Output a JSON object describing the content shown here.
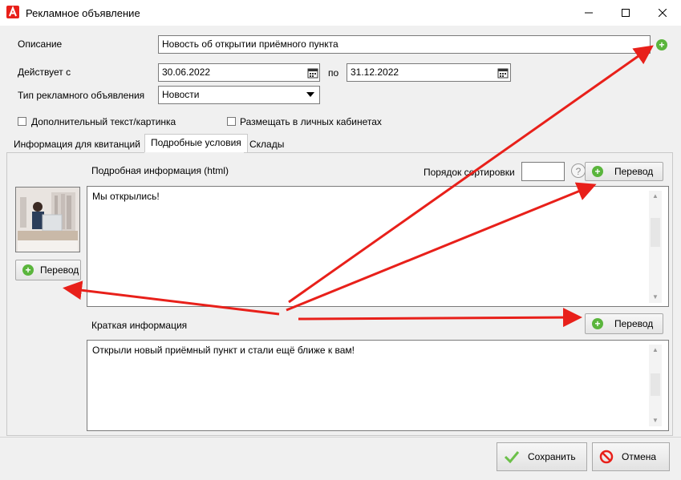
{
  "window": {
    "title": "Рекламное объявление",
    "buttons": [
      "minimize",
      "maximize",
      "close"
    ]
  },
  "form": {
    "description_label": "Описание",
    "description_value": "Новость об открытии приёмного пункта",
    "valid_from_label": "Действует с",
    "valid_from_value": "30.06.2022",
    "to_label": "по",
    "valid_to_value": "31.12.2022",
    "type_label": "Тип рекламного объявления",
    "type_value": "Новости",
    "extra_text_checkbox": "Дополнительный текст/картинка",
    "extra_text_checked": false,
    "personal_cabinets_checkbox": "Размещать в личных кабинетах",
    "personal_cabinets_checked": false
  },
  "tabs": [
    {
      "label": "Информация для квитанций",
      "active": false
    },
    {
      "label": "Подробные условия",
      "active": true
    },
    {
      "label": "Склады",
      "active": false
    }
  ],
  "details": {
    "html_label": "Подробная информация (html)",
    "sort_label": "Порядок сортировки",
    "sort_value": "",
    "help_glyph": "?",
    "translate_label": "Перевод",
    "html_text": "Мы открылись!",
    "image_translate_label": "Перевод",
    "short_label": "Краткая информация",
    "short_translate_label": "Перевод",
    "short_text": "Открыли новый приёмный пункт и стали ещё ближе к вам!"
  },
  "footer": {
    "save_label": "Сохранить",
    "cancel_label": "Отмена"
  },
  "colors": {
    "accent_red": "#e8201a",
    "plus_green": "#5ab53c",
    "check_green": "#6cc04a"
  },
  "icons": [
    "app-logo-icon",
    "calendar-icon",
    "dropdown-arrow-icon",
    "add-icon",
    "help-icon",
    "checkmark-icon",
    "cancel-icon"
  ]
}
